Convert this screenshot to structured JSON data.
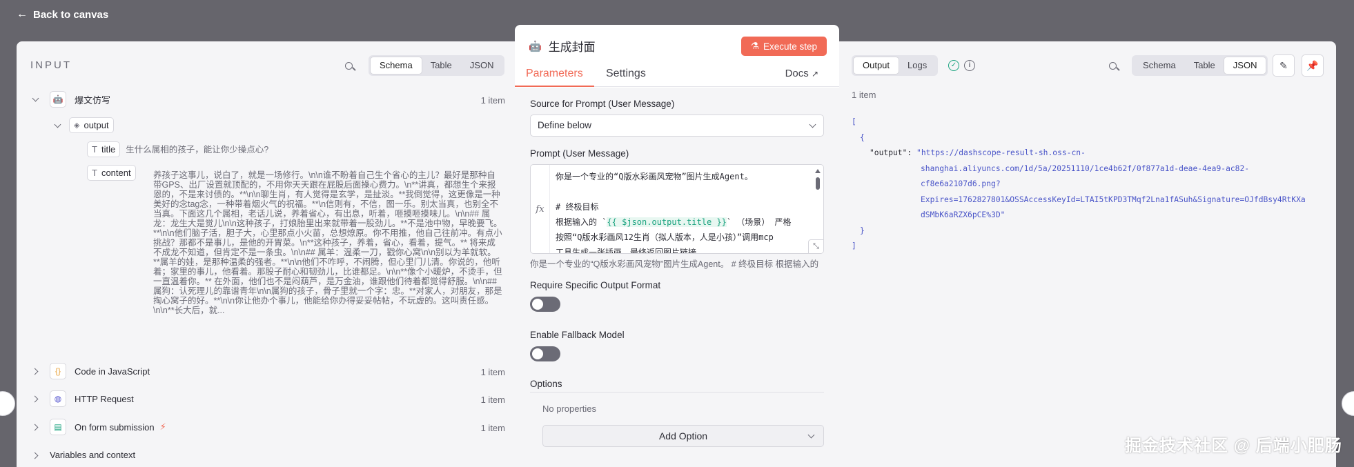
{
  "topbar": {
    "back_label": "Back to canvas"
  },
  "input": {
    "title": "INPUT",
    "view_tabs": [
      "Schema",
      "Table",
      "JSON"
    ],
    "active_view": "Schema",
    "nodes": [
      {
        "label": "爆文仿写",
        "count": "1 item",
        "expanded": true,
        "icon": "robot-icon"
      },
      {
        "label": "Code in JavaScript",
        "count": "1 item",
        "icon": "code-braces-icon"
      },
      {
        "label": "HTTP Request",
        "count": "1 item",
        "icon": "globe-icon"
      },
      {
        "label": "On form submission",
        "count": "1 item",
        "icon": "form-icon",
        "badge": "lightning-icon"
      }
    ],
    "output_label": "output",
    "fields": [
      {
        "name": "title",
        "value": "生什么属相的孩子，能让你少操点心?"
      },
      {
        "name": "content",
        "value": "养孩子这事儿，说白了，就是一场修行。\\n\\n谁不盼着自己生个省心的主儿？最好是那种自带GPS、出厂设置就顶配的，不用你天天跟在屁股后面操心费力。\\n**讲真，都想生个来报恩的，不是来讨债的。**\\n\\n聊生肖，有人觉得是玄学，是扯淡。**我倒觉得，这更像是一种美好的念tag念，一种带着烟火气的祝福。**\\n信则有，不信，图一乐。别太当真，也别全不当真。下面这几个属相，老话儿说，养着省心，有出息，听着，咂摸咂摸味儿。\\n\\n## 属龙：龙生大是觉儿\\n\\n这种孩子，打娘胎里出来就带着一股劲儿。**不是池中物，早晚要飞。**\\n\\n他们脑子活，胆子大，心里那点小火苗，总想燎原。你不用推，他自己往前冲。有点小挑战？那都不是事儿，是他的开胃菜。\\n**这种孩子，养着，省心，看着，提气。** 将来成不成龙不知道，但肯定不是一条虫。\\n\\n## 属羊：温柔一刀，戳你心窝\\n\\n别以为羊就软。**属羊的娃，是那种温柔的强者。**\\n\\n他们不咋呼，不闹腾，但心里门儿清。你说的，他听着；家里的事儿，他看着。那股子耐心和韧劲儿，比谁都足。\\n\\n**像个小暖炉，不烫手，但一直温着你。** 在外面，他们也不是闷葫芦，是万金油，谁跟他们待着都觉得舒服。\\n\\n## 属狗：认死理儿的靠谱青年\\n\\n属狗的孩子，骨子里就一个字：忠。**对家人，对朋友，那是掏心窝子的好。**\\n\\n你让他办个事儿，他能给你办得妥妥帖帖，不玩虚的。这叫责任感。\\n\\n**长大后，就..."
      }
    ],
    "variables_label": "Variables and context"
  },
  "center": {
    "node_title": "生成封面",
    "execute_label": "Execute step",
    "tabs": [
      "Parameters",
      "Settings"
    ],
    "docs_label": "Docs",
    "source_label": "Source for Prompt (User Message)",
    "source_value": "Define below",
    "prompt_label": "Prompt (User Message)",
    "prompt_lines": [
      "你是一个专业的“Q版水彩画风宠物”图片生成Agent。",
      "",
      "# 终极目标",
      "根据输入的 `",
      "{{ $json.output.title }}",
      "` （场景） 严格",
      "按照“Q版水彩画风12生肖（拟人版本，人是小孩）”调用mcp",
      "工具生成一张插画，最终返回图片链接。"
    ],
    "prompt_preview": "你是一个专业的“Q版水彩画风宠物”图片生成Agent。 # 终极目标 根据输入的",
    "require_format_label": "Require Specific Output Format",
    "fallback_label": "Enable Fallback Model",
    "options_label": "Options",
    "no_properties": "No properties",
    "add_option_label": "Add Option"
  },
  "output": {
    "tabs": [
      "Output",
      "Logs"
    ],
    "active_tab": "Output",
    "view_tabs": [
      "Schema",
      "Table",
      "JSON"
    ],
    "active_view": "JSON",
    "item_count": "1 item",
    "json_key": "\"output\"",
    "json_value_lines": [
      "\"https://dashscope-result-sh.oss-cn-",
      "shanghai.aliyuncs.com/1d/5a/20251110/1ce4b62f/0f877a1d-deae-4ea9-ac82-",
      "cf8e6a2107d6.png?",
      "Expires=1762827801&OSSAccessKeyId=LTAI5tKPD3TMqf2Lna1fASuh&Signature=OJfdBsy4RtKXa",
      "dSMbK6aRZX6pCE%3D\""
    ]
  },
  "watermark": "掘金技术社区 @ 后端小肥肠",
  "colors": {
    "accent": "#f16a56",
    "success": "#1aa37f",
    "json_string": "#4a55c8"
  }
}
